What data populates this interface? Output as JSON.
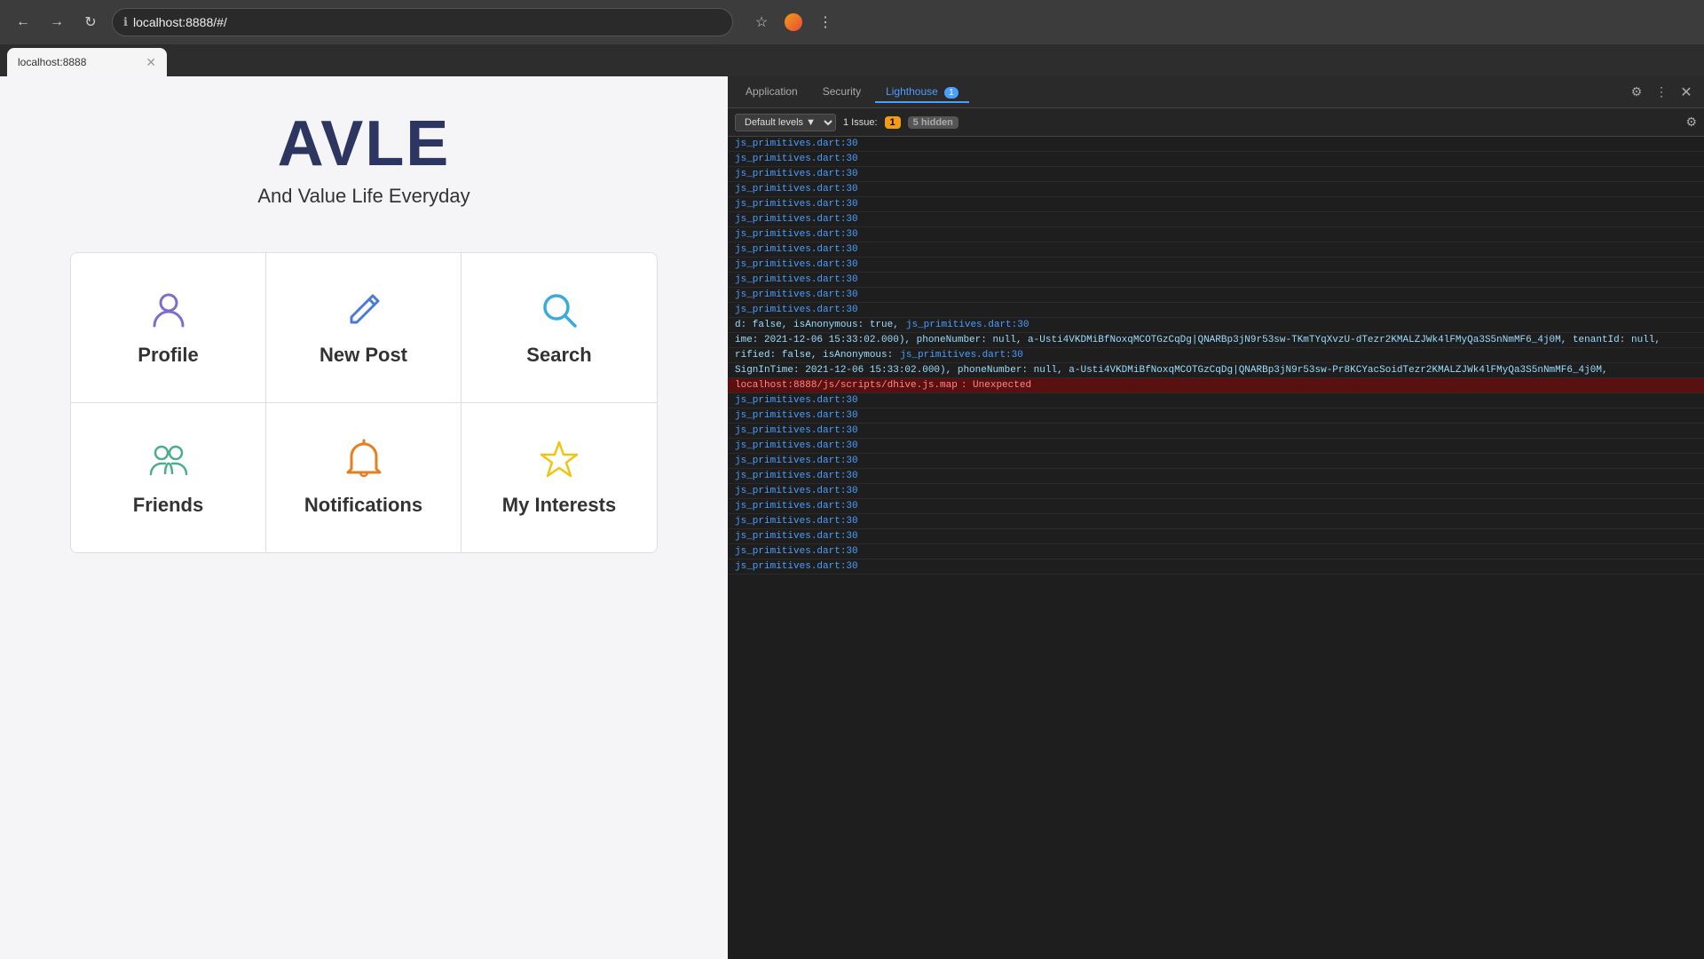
{
  "browser": {
    "url": "localhost:8888/#/",
    "tab_title": "localhost:8888",
    "nav": {
      "back": "←",
      "forward": "→",
      "reload": "↻"
    }
  },
  "devtools": {
    "tabs": [
      "Application",
      "Security",
      "Lighthouse"
    ],
    "active_tab": "Lighthouse",
    "badge_count": "1",
    "issues": {
      "label": "1 Issue:",
      "count": "1",
      "hidden_count": "5 hidden"
    },
    "filter_label": "Default levels",
    "console_lines": [
      "js_primitives.dart:30",
      "js_primitives.dart:30",
      "js_primitives.dart:30",
      "js_primitives.dart:30",
      "js_primitives.dart:30",
      "js_primitives.dart:30",
      "js_primitives.dart:30",
      "js_primitives.dart:30",
      "js_primitives.dart:30",
      "js_primitives.dart:30",
      "js_primitives.dart:30",
      "js_primitives.dart:30",
      "js_primitives.dart:30",
      "js_primitives.dart:30",
      "js_primitives.dart:30",
      "js_primitives.dart:30",
      "js_primitives.dart:30",
      "js_primitives.dart:30"
    ],
    "obj_line": "d: false, isAnonymous: true,",
    "obj_link1": "js_primitives.dart:30",
    "obj_content": "ime: 2021-12-06 15:33:02.000), phoneNumber: null, a-Usti4VKDMiBfNoxqMCOTGzCqDg|QNARBp3jN9r53sw-TKmTYqXvzU-dTezr2KMALZJWk4lFMyQa3S5nNmMF6_4j0M, tenantId: null,",
    "obj_line2": "rified: false, isAnonymous:",
    "obj_link2": "js_primitives.dart:30",
    "obj_content2": "SignInTime: 2021-12-06 15:33:02.000), phoneNumber: null, a-Usti4VKDMiBfNoxqMCOTGzCqDg|QNARBp3jN9r53sw-Pr8KCYacSoidTezr2KMALZJWk4lFMyQa3S5nNmMF6_4j0M,",
    "error_line": "localhost:8888/js/scripts/dhive.js.map: Unexpected",
    "error_link": "localhost:8888/js/scripts/dhive.js.map"
  },
  "app": {
    "logo": "AVLE",
    "tagline": "And Value Life Everyday",
    "menu_items": [
      {
        "id": "profile",
        "label": "Profile",
        "icon_type": "profile"
      },
      {
        "id": "new-post",
        "label": "New Post",
        "icon_type": "newpost"
      },
      {
        "id": "search",
        "label": "Search",
        "icon_type": "search"
      },
      {
        "id": "friends",
        "label": "Friends",
        "icon_type": "friends"
      },
      {
        "id": "notifications",
        "label": "Notifications",
        "icon_type": "notifications"
      },
      {
        "id": "my-interests",
        "label": "My Interests",
        "icon_type": "interests"
      }
    ]
  }
}
